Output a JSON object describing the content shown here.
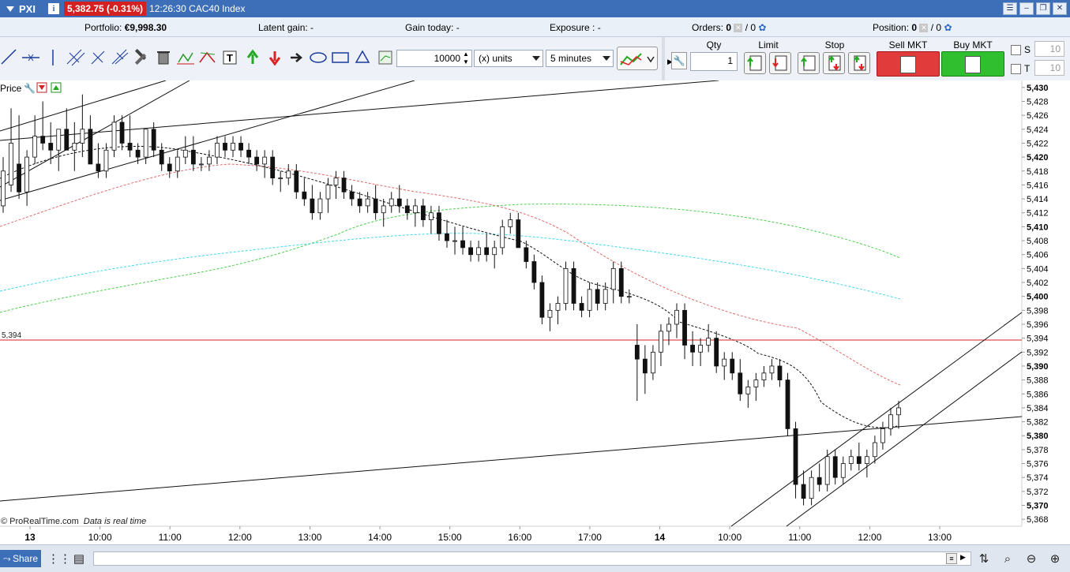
{
  "titlebar": {
    "symbol": "PXI",
    "info_icon": "i",
    "price_change": "5,382.75 (-0.31%)",
    "time_instrument": "12:26:30 CAC40 Index"
  },
  "infobar": {
    "portfolio_label": "Portfolio:",
    "portfolio_value": "€9,998.30",
    "latent_gain": "Latent gain: -",
    "gain_today": "Gain today: -",
    "exposure": "Exposure : -",
    "orders_label": "Orders:",
    "orders_a": "0",
    "orders_b": "/ 0",
    "position_label": "Position:",
    "position_a": "0",
    "position_b": "/ 0"
  },
  "toolbar": {
    "quantity": "10000",
    "units": "(x) units",
    "timeframe": "5 minutes",
    "qty_label": "Qty",
    "qty_value": "1",
    "limit_label": "Limit",
    "stop_label": "Stop",
    "sell_label": "Sell MKT",
    "buy_label": "Buy MKT",
    "s_label": "S",
    "t_label": "T",
    "s_value": "10",
    "t_value": "10"
  },
  "chart_data": {
    "type": "candlestick",
    "panel_label": "Price",
    "yaxis_ticks": [
      "5,430",
      "5,428",
      "5,426",
      "5,424",
      "5,422",
      "5,420",
      "5,418",
      "5,416",
      "5,414",
      "5,412",
      "5,410",
      "5,408",
      "5,406",
      "5,404",
      "5,402",
      "5,400",
      "5,398",
      "5,396",
      "5,394",
      "5,392",
      "5,390",
      "5,388",
      "5,386",
      "5,384",
      "5,382",
      "5,380",
      "5,378",
      "5,376",
      "5,374",
      "5,372",
      "5,370",
      "5,368"
    ],
    "bold_ticks": [
      "5,430",
      "5,420",
      "5,410",
      "5,400",
      "5,390",
      "5,380",
      "5,370"
    ],
    "ylim": [
      5367,
      5431
    ],
    "xaxis_ticks": [
      "13",
      "10:00",
      "11:00",
      "12:00",
      "13:00",
      "14:00",
      "15:00",
      "16:00",
      "17:00",
      "14",
      "10:00",
      "11:00",
      "12:00",
      "13:00"
    ],
    "horizontal_line_label": "5,394",
    "horizontal_line_value": 5394,
    "ohlc_rounded": [
      [
        5413,
        5420,
        5412,
        5418
      ],
      [
        5416,
        5427,
        5415,
        5422
      ],
      [
        5419,
        5426,
        5414,
        5415
      ],
      [
        5415,
        5421,
        5413,
        5420
      ],
      [
        5420,
        5426,
        5419,
        5423
      ],
      [
        5423,
        5428,
        5421,
        5422
      ],
      [
        5422,
        5425,
        5419,
        5421
      ],
      [
        5421,
        5424,
        5418,
        5424
      ],
      [
        5424,
        5427,
        5421,
        5421
      ],
      [
        5421,
        5425,
        5418,
        5422
      ],
      [
        5422,
        5429,
        5420,
        5424
      ],
      [
        5424,
        5426,
        5419,
        5419
      ],
      [
        5419,
        5422,
        5417,
        5418
      ],
      [
        5418,
        5422,
        5417,
        5421
      ],
      [
        5421,
        5426,
        5420,
        5425
      ],
      [
        5425,
        5426,
        5421,
        5422
      ],
      [
        5422,
        5426,
        5420,
        5421
      ],
      [
        5421,
        5422,
        5419,
        5420
      ],
      [
        5420,
        5424,
        5419,
        5424
      ],
      [
        5424,
        5425,
        5420,
        5421
      ],
      [
        5421,
        5422,
        5418,
        5419
      ],
      [
        5419,
        5420,
        5417,
        5418
      ],
      [
        5418,
        5421,
        5417,
        5420
      ],
      [
        5420,
        5423,
        5419,
        5421
      ],
      [
        5421,
        5423,
        5418,
        5419
      ],
      [
        5419,
        5420,
        5418,
        5419
      ],
      [
        5419,
        5421,
        5418,
        5420
      ],
      [
        5420,
        5423,
        5419,
        5422
      ],
      [
        5422,
        5423,
        5420,
        5421
      ],
      [
        5421,
        5423,
        5420,
        5422
      ],
      [
        5422,
        5423,
        5420,
        5421
      ],
      [
        5421,
        5422,
        5419,
        5420
      ],
      [
        5420,
        5421,
        5418,
        5419
      ],
      [
        5419,
        5421,
        5417,
        5420
      ],
      [
        5420,
        5421,
        5416,
        5417
      ],
      [
        5417,
        5418,
        5415,
        5417
      ],
      [
        5417,
        5419,
        5416,
        5418
      ],
      [
        5418,
        5419,
        5414,
        5415
      ],
      [
        5415,
        5417,
        5413,
        5414
      ],
      [
        5414,
        5416,
        5411,
        5412
      ],
      [
        5412,
        5415,
        5411,
        5414
      ],
      [
        5414,
        5417,
        5412,
        5416
      ],
      [
        5416,
        5418,
        5414,
        5417
      ],
      [
        5417,
        5418,
        5414,
        5415
      ],
      [
        5415,
        5416,
        5413,
        5414
      ],
      [
        5414,
        5415,
        5412,
        5413
      ],
      [
        5413,
        5415,
        5412,
        5414
      ],
      [
        5414,
        5416,
        5411,
        5412
      ],
      [
        5412,
        5414,
        5410,
        5413
      ],
      [
        5413,
        5415,
        5412,
        5414
      ],
      [
        5414,
        5416,
        5412,
        5413
      ],
      [
        5413,
        5414,
        5411,
        5412
      ],
      [
        5412,
        5414,
        5410,
        5413
      ],
      [
        5413,
        5414,
        5410,
        5411
      ],
      [
        5411,
        5413,
        5409,
        5412
      ],
      [
        5412,
        5413,
        5408,
        5409
      ],
      [
        5409,
        5411,
        5407,
        5408
      ],
      [
        5408,
        5410,
        5406,
        5408
      ],
      [
        5408,
        5410,
        5406,
        5407
      ],
      [
        5407,
        5408,
        5405,
        5406
      ],
      [
        5406,
        5408,
        5405,
        5407
      ],
      [
        5407,
        5409,
        5405,
        5406
      ],
      [
        5406,
        5408,
        5404,
        5407
      ],
      [
        5407,
        5411,
        5406,
        5410
      ],
      [
        5410,
        5412,
        5409,
        5411
      ],
      [
        5411,
        5412,
        5407,
        5407
      ],
      [
        5407,
        5408,
        5404,
        5405
      ],
      [
        5405,
        5406,
        5401,
        5402
      ],
      [
        5402,
        5403,
        5396,
        5397
      ],
      [
        5397,
        5399,
        5395,
        5398
      ],
      [
        5398,
        5400,
        5396,
        5399
      ],
      [
        5399,
        5405,
        5398,
        5404
      ],
      [
        5404,
        5405,
        5398,
        5399
      ],
      [
        5399,
        5400,
        5397,
        5398
      ],
      [
        5398,
        5402,
        5397,
        5401
      ],
      [
        5401,
        5402,
        5398,
        5399
      ],
      [
        5399,
        5402,
        5398,
        5401
      ],
      [
        5401,
        5405,
        5399,
        5404
      ],
      [
        5404,
        5405,
        5399,
        5400
      ],
      [
        5400,
        5401,
        5399,
        5400
      ],
      [
        5393,
        5396,
        5385,
        5391
      ],
      [
        5391,
        5393,
        5386,
        5389
      ],
      [
        5389,
        5393,
        5388,
        5392
      ],
      [
        5392,
        5396,
        5390,
        5395
      ],
      [
        5395,
        5397,
        5393,
        5396
      ],
      [
        5396,
        5399,
        5394,
        5398
      ],
      [
        5398,
        5399,
        5391,
        5393
      ],
      [
        5393,
        5395,
        5390,
        5392
      ],
      [
        5392,
        5394,
        5390,
        5393
      ],
      [
        5393,
        5396,
        5392,
        5394
      ],
      [
        5394,
        5395,
        5389,
        5390
      ],
      [
        5390,
        5392,
        5388,
        5391
      ],
      [
        5391,
        5392,
        5388,
        5389
      ],
      [
        5389,
        5391,
        5385,
        5386
      ],
      [
        5386,
        5388,
        5384,
        5387
      ],
      [
        5387,
        5389,
        5385,
        5388
      ],
      [
        5388,
        5390,
        5387,
        5389
      ],
      [
        5389,
        5391,
        5388,
        5390
      ],
      [
        5390,
        5391,
        5387,
        5388
      ],
      [
        5388,
        5389,
        5380,
        5381
      ],
      [
        5381,
        5382,
        5371,
        5373
      ],
      [
        5373,
        5375,
        5370,
        5371
      ],
      [
        5371,
        5375,
        5370,
        5374
      ],
      [
        5374,
        5376,
        5372,
        5373
      ],
      [
        5373,
        5378,
        5372,
        5377
      ],
      [
        5377,
        5378,
        5373,
        5374
      ],
      [
        5374,
        5377,
        5373,
        5376
      ],
      [
        5376,
        5378,
        5375,
        5377
      ],
      [
        5377,
        5379,
        5375,
        5376
      ],
      [
        5376,
        5378,
        5374,
        5377
      ],
      [
        5377,
        5380,
        5376,
        5379
      ],
      [
        5379,
        5382,
        5378,
        5381
      ],
      [
        5381,
        5384,
        5380,
        5383
      ],
      [
        5383,
        5385,
        5381,
        5384
      ]
    ]
  },
  "footer": {
    "prorealtime": "© ProRealTime.com",
    "realtime": "Data is real time",
    "share": "Share"
  }
}
